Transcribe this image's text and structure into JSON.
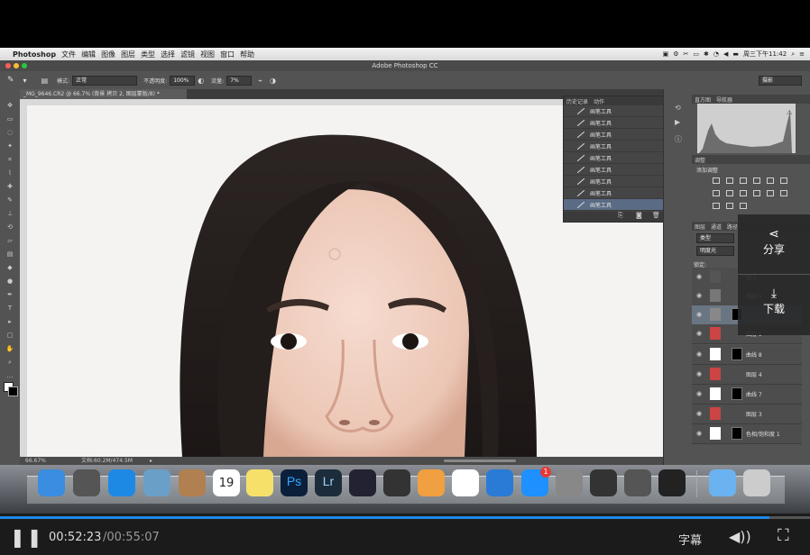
{
  "menubar": {
    "app": "Photoshop",
    "items": [
      "文件",
      "编辑",
      "图像",
      "图层",
      "类型",
      "选择",
      "滤镜",
      "视图",
      "窗口",
      "帮助"
    ],
    "clock": "周三下午11:42"
  },
  "window": {
    "title": "Adobe Photoshop CC"
  },
  "options": {
    "mode_label": "模式:",
    "mode_value": "正常",
    "opacity_label": "不透明度:",
    "opacity_value": "100%",
    "flow_label": "流量:",
    "flow_value": "7%",
    "workspace": "摄影"
  },
  "document": {
    "tab": "_MG_9646.CR2 @ 66.7% (背景 拷贝 2, 图层蒙版/8) *",
    "zoom": "66.67%",
    "doc_info": "文档:60.2M/474.5M"
  },
  "history": {
    "tabs": [
      "历史记录",
      "动作"
    ],
    "items": [
      "画笔工具",
      "画笔工具",
      "画笔工具",
      "画笔工具",
      "画笔工具",
      "画笔工具",
      "画笔工具",
      "画笔工具",
      "画笔工具"
    ]
  },
  "panels": {
    "histogram_tabs": [
      "直方图",
      "导航器"
    ],
    "adjust_tab": "调整",
    "adjust_title": "添加调整",
    "layers_tabs": [
      "图层",
      "通道",
      "路径"
    ],
    "filter": "类型",
    "blend": "明度光",
    "lock": "锁定:"
  },
  "layers": [
    {
      "name": "组 1"
    },
    {
      "name": "图层 9"
    },
    {
      "name": ""
    },
    {
      "name": "图层 5"
    },
    {
      "name": "曲线 8"
    },
    {
      "name": "图层 4"
    },
    {
      "name": "曲线 7"
    },
    {
      "name": "图层 3"
    },
    {
      "name": "色相/饱和度 1"
    }
  ],
  "share": {
    "share_label": "分享",
    "download_label": "下载"
  },
  "dock": {
    "calendar_day": "19",
    "appstore_badge": "1",
    "ps_label": "Ps",
    "lr_label": "Lr"
  },
  "video": {
    "current": "00:52:23",
    "total": "/00:55:07",
    "subtitle_label": "字幕",
    "progress": 0.95
  }
}
